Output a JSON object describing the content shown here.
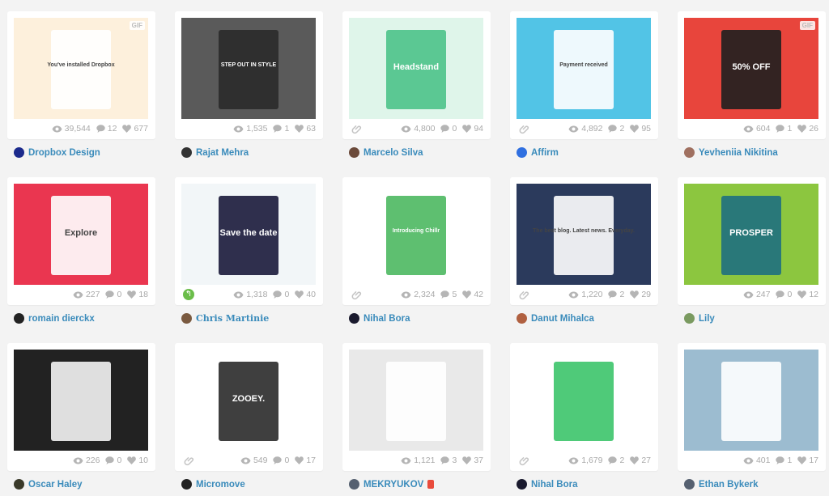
{
  "shots": [
    {
      "user": "Dropbox Design",
      "avatar": "#1b2a8c",
      "views": "39,544",
      "comments": "12",
      "likes": "677",
      "bg": "#fdf0dc",
      "fg": "#ffffff",
      "gif": "GIF",
      "thumb_text": "You've installed Dropbox"
    },
    {
      "user": "Rajat Mehra",
      "avatar": "#333333",
      "views": "1,535",
      "comments": "1",
      "likes": "63",
      "bg": "#5a5a5a",
      "fg": "#2a2a2a",
      "thumb_text": "STEP OUT IN STYLE"
    },
    {
      "user": "Marcelo Silva",
      "avatar": "#6b4a3a",
      "views": "4,800",
      "comments": "0",
      "likes": "94",
      "bg": "#dff5ea",
      "fg": "#4cc38a",
      "link": true,
      "thumb_text": "Headstand"
    },
    {
      "user": "Affirm",
      "avatar": "#2f6fe0",
      "views": "4,892",
      "comments": "2",
      "likes": "95",
      "bg": "#52c4e6",
      "fg": "#ffffff",
      "link": true,
      "thumb_text": "Payment received"
    },
    {
      "user": "Yevheniia Nikitina",
      "avatar": "#a07060",
      "views": "604",
      "comments": "1",
      "likes": "26",
      "bg": "#e8453c",
      "fg": "#1f1f1f",
      "gif": "GIF",
      "thumb_text": "50% OFF"
    },
    {
      "user": "romain dierckx",
      "avatar": "#222222",
      "views": "227",
      "comments": "0",
      "likes": "18",
      "bg": "#ea3650",
      "fg": "#ffffff",
      "thumb_text": "Explore"
    },
    {
      "user": "Chris Martinie",
      "avatar": "#7a5a40",
      "views": "1,318",
      "comments": "0",
      "likes": "40",
      "bg": "#f2f6f8",
      "fg": "#1a1a3a",
      "rebound": true,
      "fancy": true,
      "thumb_text": "Save the date"
    },
    {
      "user": "Nihal Bora",
      "avatar": "#1a1a2e",
      "views": "2,324",
      "comments": "5",
      "likes": "42",
      "bg": "#ffffff",
      "fg": "#4cb860",
      "link": true,
      "thumb_text": "Introducing Chillr"
    },
    {
      "user": "Danut Mihalca",
      "avatar": "#b06040",
      "views": "1,220",
      "comments": "2",
      "likes": "29",
      "bg": "#2b3a5c",
      "fg": "#ffffff",
      "link": true,
      "thumb_text": "The best blog. Latest news. Everyday."
    },
    {
      "user": "Lily",
      "avatar": "#7a9a60",
      "views": "247",
      "comments": "0",
      "likes": "12",
      "bg": "#8cc63f",
      "fg": "#1e6f80",
      "thumb_text": "PROSPER"
    },
    {
      "user": "Oscar Haley",
      "avatar": "#3a3a2a",
      "views": "226",
      "comments": "0",
      "likes": "10",
      "bg": "#222222",
      "fg": "#f4f4f4",
      "thumb_text": ""
    },
    {
      "user": "Micromove",
      "avatar": "#222222",
      "views": "549",
      "comments": "0",
      "likes": "17",
      "bg": "#ffffff",
      "fg": "#2a2a2a",
      "link": true,
      "thumb_text": "ZOOEY."
    },
    {
      "user": "MEKRYUKOV",
      "avatar": "#556070",
      "views": "1,121",
      "comments": "3",
      "likes": "37",
      "bg": "#e9e9e9",
      "fg": "#ffffff",
      "pro": true,
      "thumb_text": ""
    },
    {
      "user": "Nihal Bora",
      "avatar": "#1a1a2e",
      "views": "1,679",
      "comments": "2",
      "likes": "27",
      "bg": "#ffffff",
      "fg": "#3cc46a",
      "link": true,
      "thumb_text": ""
    },
    {
      "user": "Ethan Bykerk",
      "avatar": "#556070",
      "views": "401",
      "comments": "1",
      "likes": "17",
      "bg": "#9cbcd0",
      "fg": "#ffffff",
      "thumb_text": ""
    }
  ],
  "colors": {
    "background": "#f3f3f3",
    "username": "#3a8bbb",
    "stat": "#aaaaaa"
  }
}
